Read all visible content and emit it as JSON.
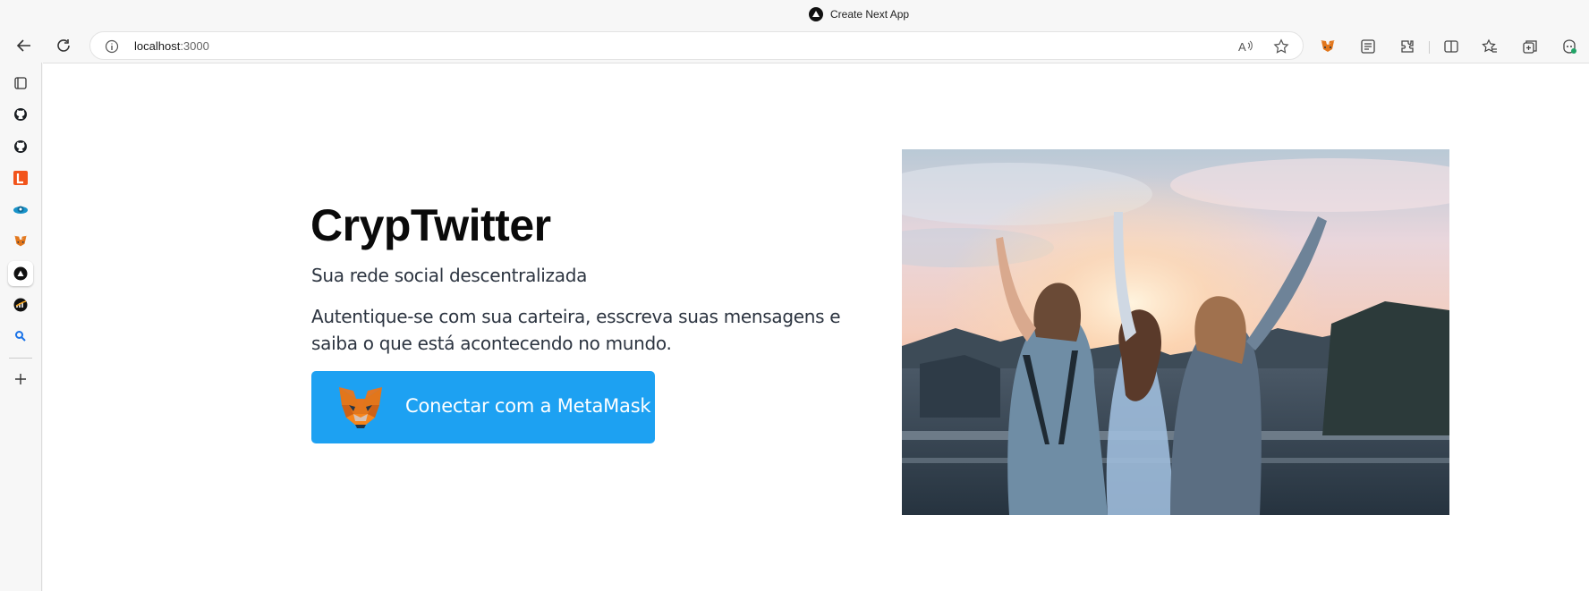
{
  "window": {
    "title": "Create Next App"
  },
  "address_bar": {
    "url_host": "localhost",
    "url_port": ":3000"
  },
  "page": {
    "title": "CrypTwitter",
    "subtitle": "Sua rede social descentralizada",
    "description": "Autentique-se com sua carteira, esscreva suas mensagens e saiba o que está acontecendo no mundo.",
    "connect_button_label": "Conectar com a MetaMask"
  },
  "colors": {
    "accent": "#1da1f2",
    "metamask_orange": "#e2761b"
  },
  "icons": {
    "toolbar": [
      "back-icon",
      "refresh-icon",
      "info-icon",
      "read-aloud-icon",
      "favorite-star-icon"
    ],
    "extensions": [
      "metamask-icon",
      "collections-icon",
      "extensions-icon",
      "split-screen-icon",
      "favorites-icon",
      "browser-essentials-icon",
      "copilot-icon"
    ],
    "sidebar": [
      "tab-actions-icon",
      "github-icon",
      "github-icon",
      "l-app-icon",
      "bluesky-icon",
      "metamask-icon",
      "nextjs-icon",
      "analytics-icon",
      "search-icon",
      "add-icon"
    ]
  }
}
